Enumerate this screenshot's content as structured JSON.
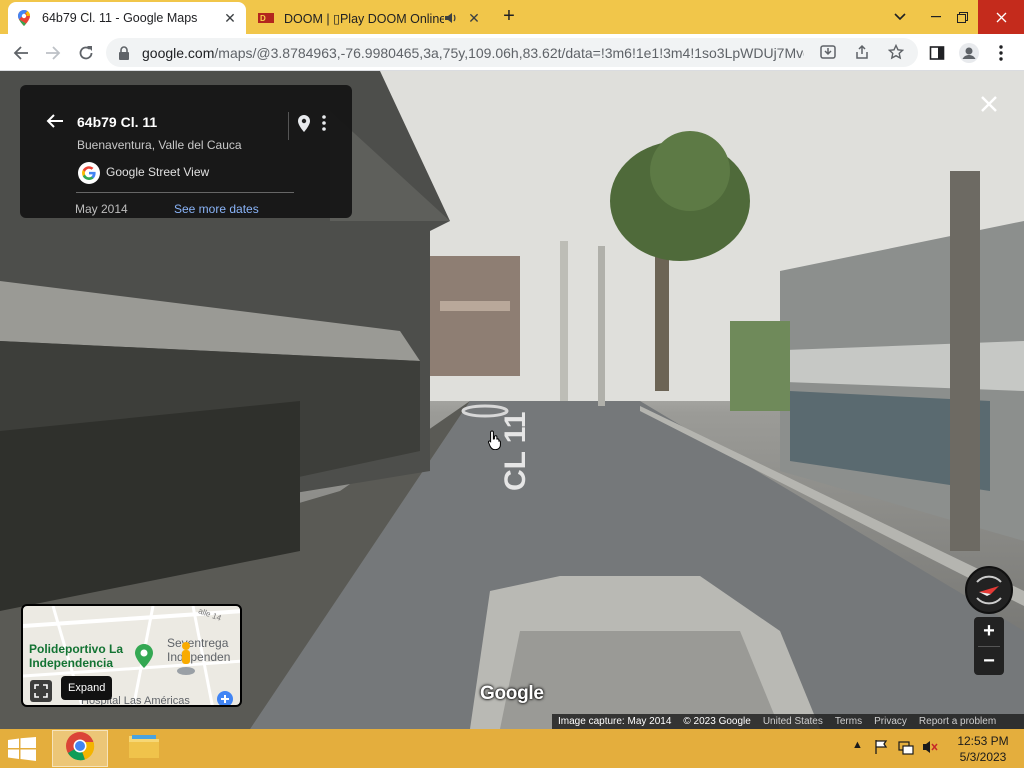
{
  "browser": {
    "tabs": [
      {
        "title": "64b79 Cl. 11 - Google Maps",
        "favicon": "google-maps-pin-icon",
        "active": true
      },
      {
        "title": "DOOM | ▯Play DOOM Online",
        "favicon": "doom-icon",
        "audio": "speaker-icon",
        "active": false
      }
    ],
    "new_tab": "+",
    "url_host": "google.com",
    "url_path": "/maps/@3.8784963,-76.9980465,3a,75y,109.06h,83.62t/data=!3m6!1e1!3m4!1so3LpWDUj7Mvq...",
    "colors": {
      "tabstrip": "#f1c64a",
      "taskbar": "#e4ae3d",
      "link": "#8ab4f8"
    }
  },
  "streetview": {
    "address_title": "64b79 Cl. 11",
    "address_subtitle": "Buenaventura, Valle del Cauca",
    "provider": "Google Street View",
    "capture_date": "May 2014",
    "see_more_dates": "See more dates",
    "road_marking": "CL 11",
    "watermark": "Google",
    "minimap": {
      "place1": "Polideportivo La Independencia",
      "place2": "Seventrega Independen",
      "place3": "Hospital Las Américas",
      "street": "alle 14",
      "expand_tooltip": "Expand"
    },
    "footer": {
      "capture": "Image capture: May 2014",
      "copyright": "© 2023 Google",
      "country": "United States",
      "terms": "Terms",
      "privacy": "Privacy",
      "report": "Report a problem"
    }
  },
  "taskbar": {
    "time": "12:53 PM",
    "date": "5/3/2023"
  }
}
